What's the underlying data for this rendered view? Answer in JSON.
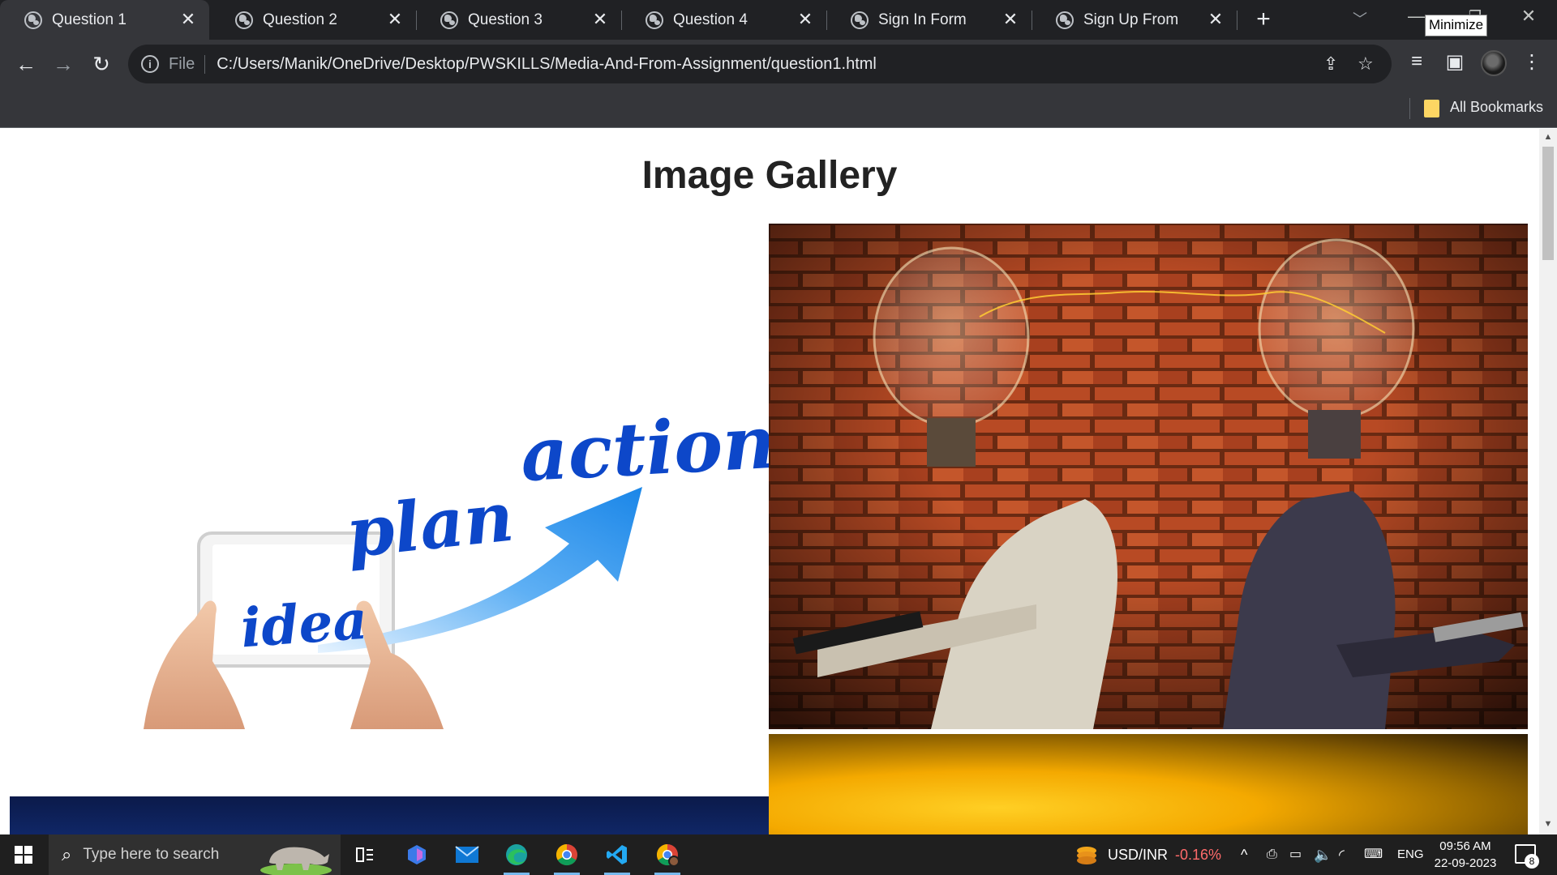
{
  "browser": {
    "tabs": [
      {
        "title": "Question 1",
        "active": true
      },
      {
        "title": "Question 2",
        "active": false
      },
      {
        "title": "Question 3",
        "active": false
      },
      {
        "title": "Question 4",
        "active": false
      },
      {
        "title": "Sign In Form",
        "active": false
      },
      {
        "title": "Sign Up From",
        "active": false
      }
    ],
    "tooltip": "Minimize",
    "address_bar": {
      "scheme_label": "File",
      "url": "C:/Users/Manik/OneDrive/Desktop/PWSKILLS/Media-And-From-Assignment/question1.html"
    },
    "bookmarks_bar": {
      "all_bookmarks_label": "All Bookmarks"
    }
  },
  "page": {
    "title": "Image Gallery",
    "images": [
      {
        "subject": "idea-plan-action-tablet"
      },
      {
        "subject": "lightbulb-heads-at-laptops"
      },
      {
        "subject": "blue-screen"
      },
      {
        "subject": "yellow-glow"
      }
    ],
    "idea_image_words": [
      "idea",
      "plan",
      "action"
    ]
  },
  "taskbar": {
    "search_placeholder": "Type here to search",
    "ticker_label": "USD/INR",
    "ticker_change": "-0.16%",
    "language": "ENG",
    "time": "09:56 AM",
    "date": "22-09-2023",
    "notification_count": "8",
    "colors": {
      "ticker_negative": "#ff6b6b"
    }
  }
}
